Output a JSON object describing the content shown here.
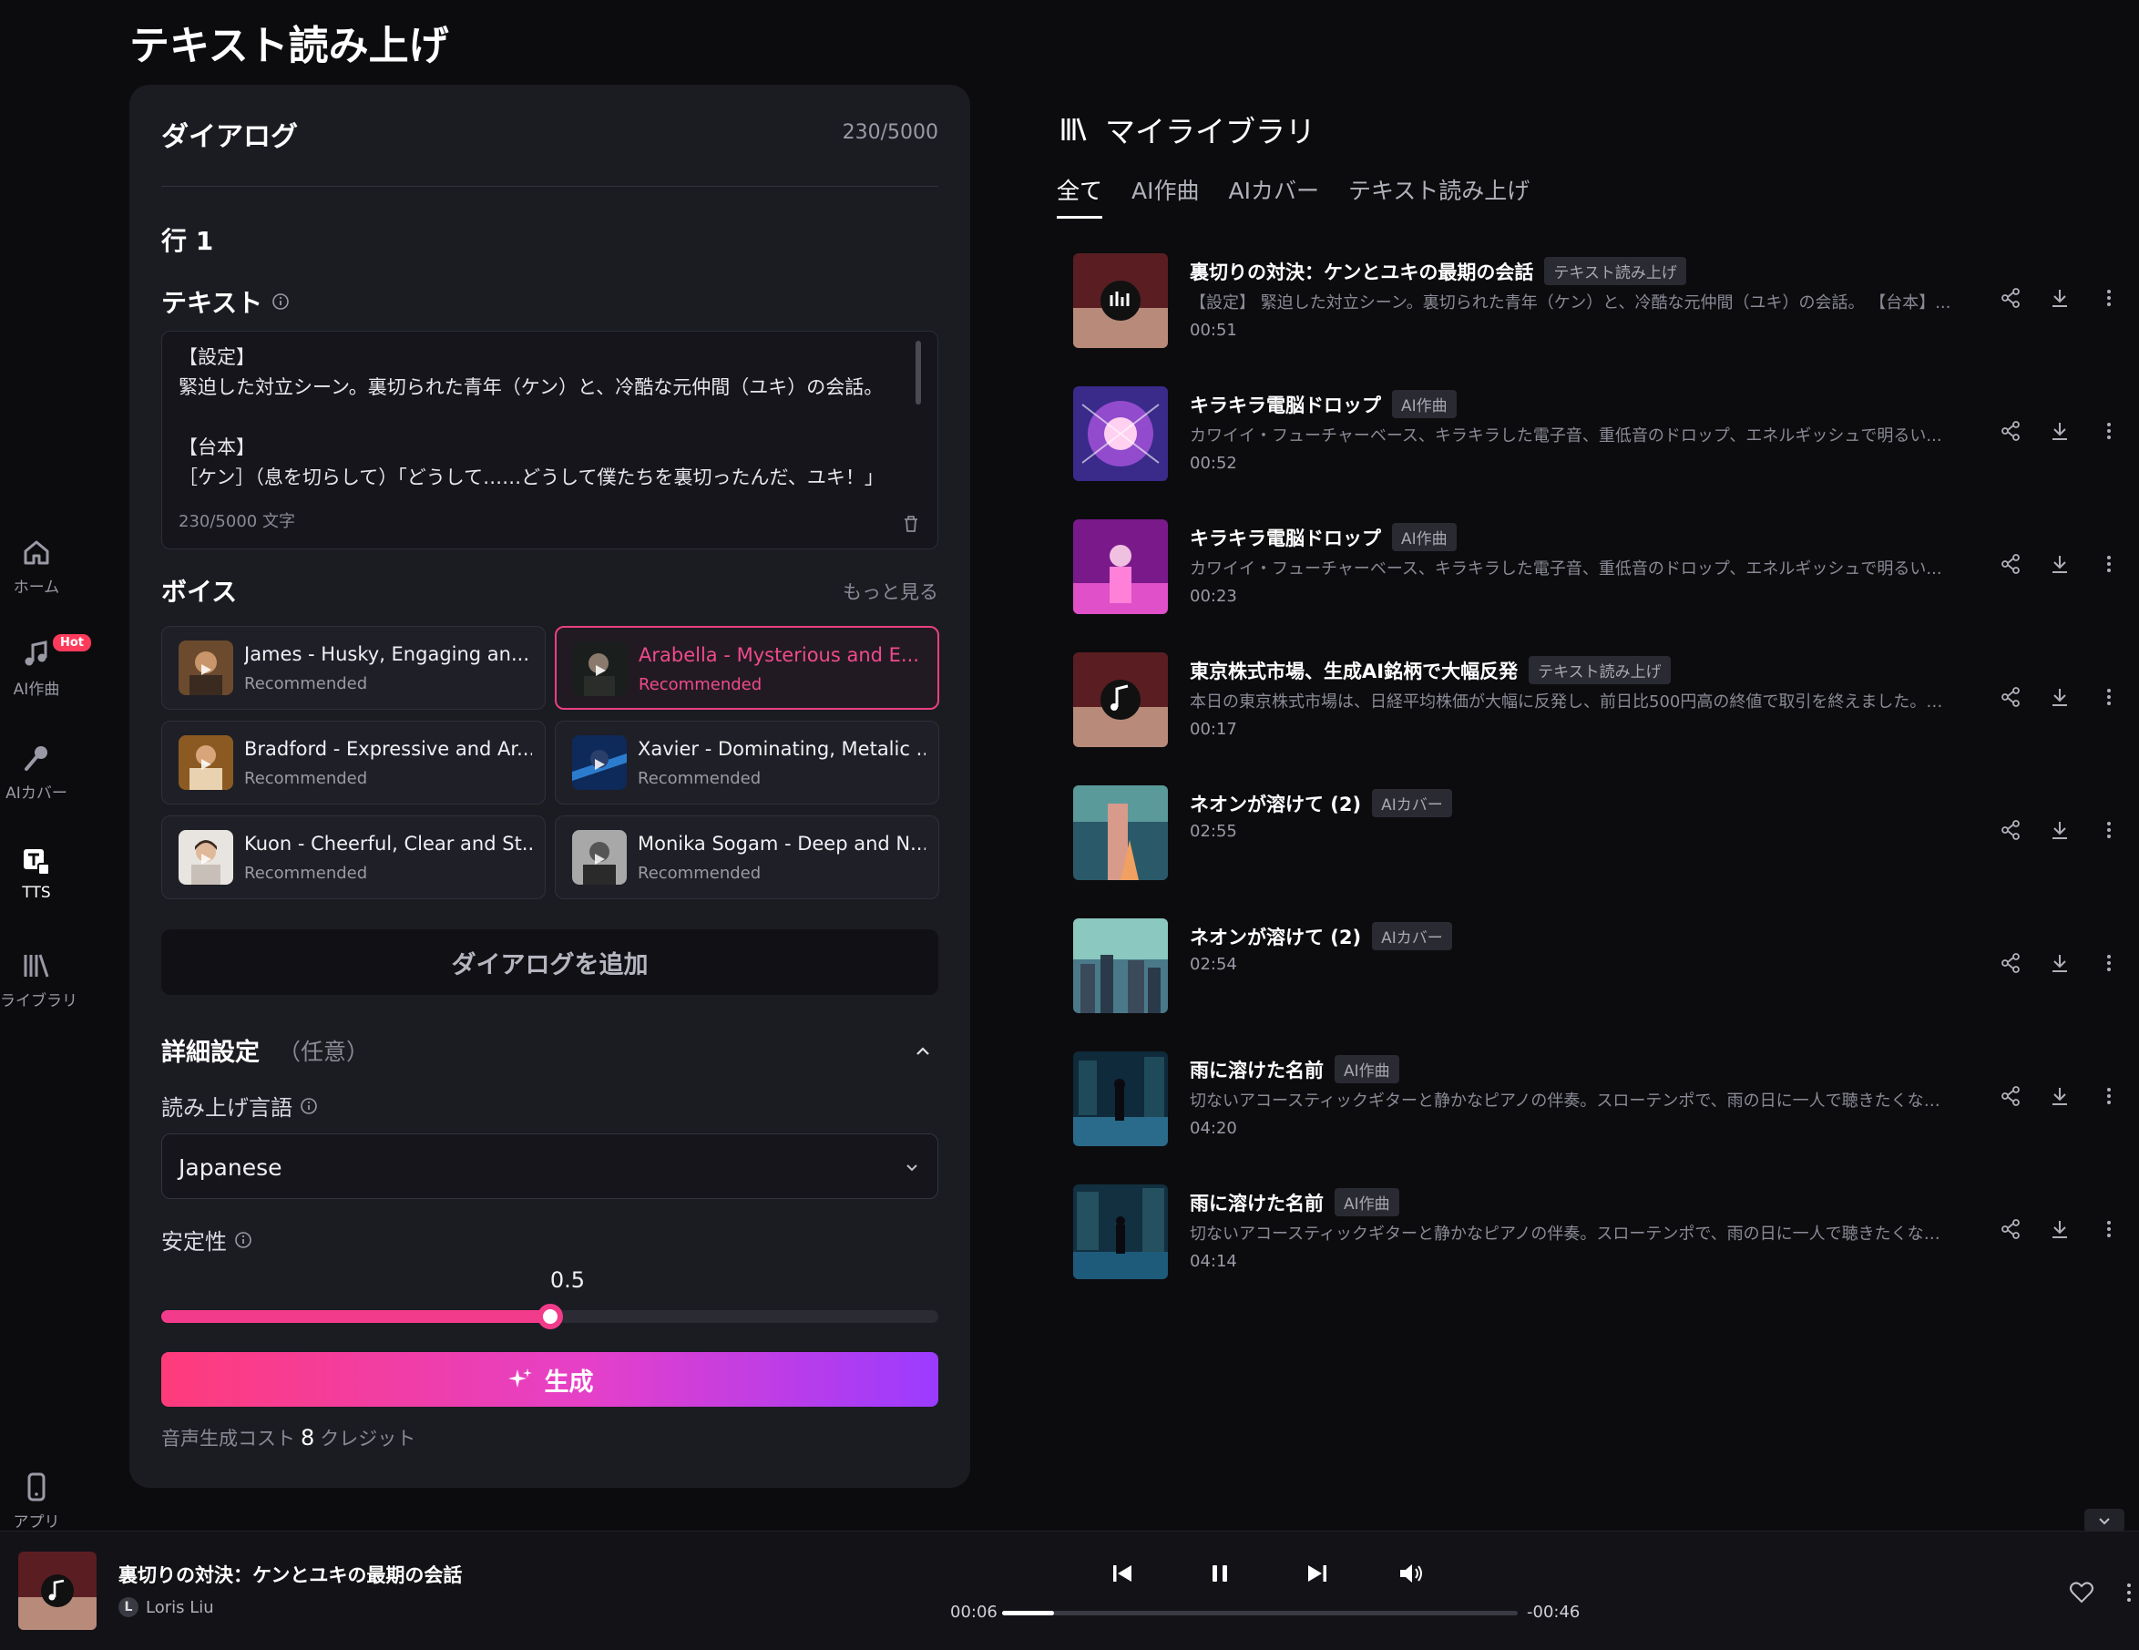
{
  "sidebar": {
    "items": [
      {
        "label": "ホーム",
        "icon": "home-icon"
      },
      {
        "label": "AI作曲",
        "icon": "music-note-icon",
        "badge": "Hot"
      },
      {
        "label": "AIカバー",
        "icon": "microphone-icon"
      },
      {
        "label": "TTS",
        "icon": "text-to-speech-icon",
        "active": true
      },
      {
        "label": "ライブラリ",
        "icon": "library-icon"
      },
      {
        "label": "アプリ",
        "icon": "phone-icon"
      }
    ]
  },
  "page": {
    "title": "テキスト読み上げ"
  },
  "dialog": {
    "title": "ダイアログ",
    "count": "230/5000",
    "row_label": "行 1",
    "text_label": "テキスト",
    "text_lines": [
      "【設定】",
      "緊迫した対立シーン。裏切られた青年（ケン）と、冷酷な元仲間（ユキ）の会話。",
      "",
      "【台本】",
      "［ケン］（息を切らして）「どうして……どうして僕たちを裏切ったんだ、ユキ！」"
    ],
    "char_count": "230/5000 文字"
  },
  "voices": {
    "label": "ボイス",
    "more": "もっと見る",
    "items": [
      {
        "name": "James - Husky, Engaging an...",
        "sub": "Recommended"
      },
      {
        "name": "Arabella - Mysterious and E...",
        "sub": "Recommended",
        "selected": true
      },
      {
        "name": "Bradford - Expressive and Ar...",
        "sub": "Recommended"
      },
      {
        "name": "Xavier - Dominating, Metalic ...",
        "sub": "Recommended"
      },
      {
        "name": "Kuon - Cheerful, Clear and St...",
        "sub": "Recommended"
      },
      {
        "name": "Monika Sogam - Deep and N...",
        "sub": "Recommended"
      }
    ]
  },
  "add_dialog": "ダイアログを追加",
  "advanced": {
    "title": "詳細設定",
    "optional": "（任意）",
    "language_label": "読み上げ言語",
    "language_value": "Japanese",
    "stability_label": "安定性",
    "stability_value": "0.5",
    "stability_fraction": 0.5
  },
  "generate": {
    "label": "生成"
  },
  "cost": {
    "prefix": "音声生成コスト",
    "amount": "8",
    "suffix": "クレジット"
  },
  "library": {
    "title": "マイライブラリ",
    "tabs": [
      {
        "label": "全て",
        "active": true
      },
      {
        "label": "AI作曲"
      },
      {
        "label": "AIカバー"
      },
      {
        "label": "テキスト読み上げ"
      }
    ],
    "tracks": [
      {
        "title": "裏切りの対決：ケンとユキの最期の会話",
        "tag": "テキスト読み上げ",
        "desc": "【設定】 緊迫した対立シーン。裏切られた青年（ケン）と、冷酷な元仲間（ユキ）の会話。 【台本】...",
        "duration": "00:51"
      },
      {
        "title": "キラキラ電脳ドロップ",
        "tag": "AI作曲",
        "desc": "カワイイ・フューチャーベース、キラキラした電子音、重低音のドロップ、エネルギッシュで明るい...",
        "duration": "00:52"
      },
      {
        "title": "キラキラ電脳ドロップ",
        "tag": "AI作曲",
        "desc": "カワイイ・フューチャーベース、キラキラした電子音、重低音のドロップ、エネルギッシュで明るい...",
        "duration": "00:23"
      },
      {
        "title": "東京株式市場、生成AI銘柄で大幅反発",
        "tag": "テキスト読み上げ",
        "desc": "本日の東京株式市場は、日経平均株価が大幅に反発し、前日比500円高の終値で取引を終えました。特...",
        "duration": "00:17"
      },
      {
        "title": "ネオンが溶けて (2)",
        "tag": "AIカバー",
        "desc": "",
        "duration": "02:55"
      },
      {
        "title": "ネオンが溶けて (2)",
        "tag": "AIカバー",
        "desc": "",
        "duration": "02:54"
      },
      {
        "title": "雨に溶けた名前",
        "tag": "AI作曲",
        "desc": "切ないアコースティックギターと静かなピアノの伴奏。スローテンポで、雨の日に一人で聴きたくなる...",
        "duration": "04:20"
      },
      {
        "title": "雨に溶けた名前",
        "tag": "AI作曲",
        "desc": "切ないアコースティックギターと静かなピアノの伴奏。スローテンポで、雨の日に一人で聴きたくなる...",
        "duration": "04:14"
      }
    ]
  },
  "player": {
    "title": "裏切りの対決：ケンとユキの最期の会話",
    "artist_initial": "L",
    "artist": "Loris Liu",
    "time_current": "00:06",
    "time_remaining": "-00:46",
    "progress_fraction": 0.1,
    "state": "playing"
  },
  "colors": {
    "accent_pink": "#f33b8b",
    "gradient_start": "#ff3b7a",
    "gradient_end": "#9b3bff",
    "panel_bg": "#1b1b22",
    "page_bg": "#0c0c0f"
  }
}
